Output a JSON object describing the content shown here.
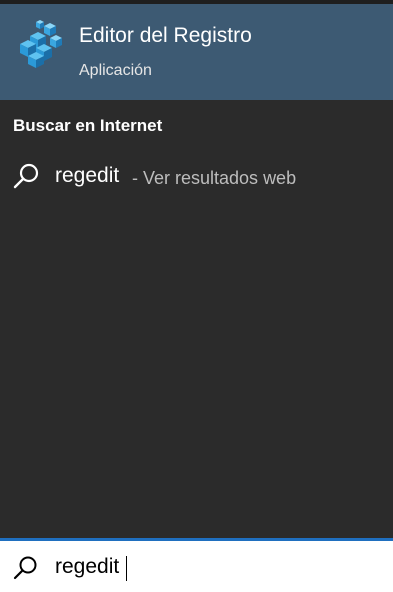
{
  "best_match": {
    "title": "Editor del Registro",
    "subtitle": "Aplicación",
    "icon": "registry-editor-icon"
  },
  "web_section": {
    "header": "Buscar en Internet",
    "query": "regedit",
    "suffix": "- Ver resultados web",
    "icon": "search-icon"
  },
  "search_box": {
    "value": "regedit",
    "icon": "search-icon"
  },
  "colors": {
    "panel_bg": "#2b2b2b",
    "best_match_bg": "#3d5a73",
    "accent": "#1f6fbf",
    "icon_blue": "#2b9ad8"
  }
}
